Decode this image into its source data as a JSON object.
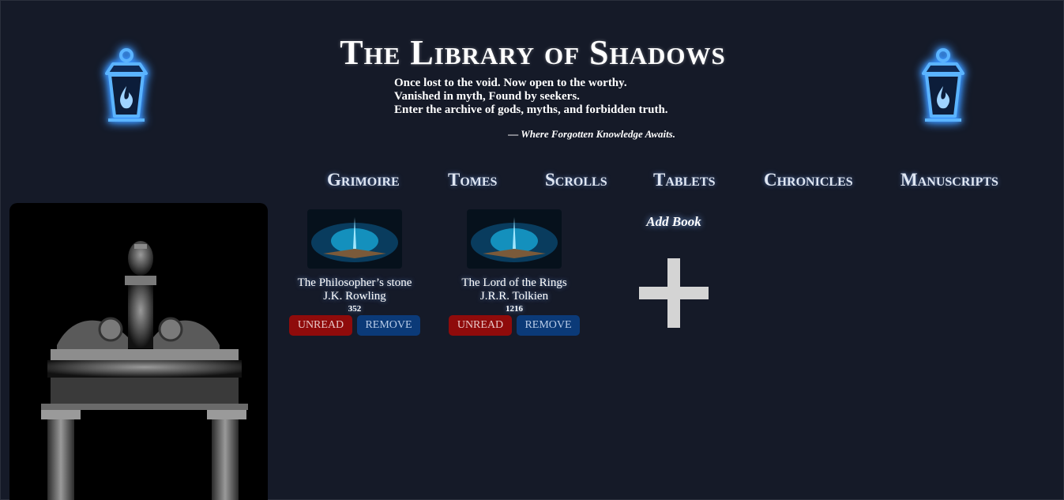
{
  "header": {
    "title": "The Library of Shadows",
    "subtitle_lines": [
      "Once lost to the void. Now open to the worthy.",
      "Vanished in myth, Found by seekers.",
      "Enter the archive of gods, myths, and forbidden truth."
    ],
    "tagline": "— Where Forgotten Knowledge Awaits."
  },
  "icons": {
    "left_lantern": "lantern-icon",
    "right_lantern": "lantern-icon",
    "add": "plus-icon"
  },
  "nav": {
    "items": [
      {
        "label": "Grimoire"
      },
      {
        "label": "Tomes"
      },
      {
        "label": "Scrolls"
      },
      {
        "label": "Tablets"
      },
      {
        "label": "Chronicles"
      },
      {
        "label": "Manuscripts"
      }
    ]
  },
  "books": [
    {
      "title": "The Philosopher’s stone",
      "author": "J.K. Rowling",
      "pages": "352",
      "status_label": "UNREAD",
      "remove_label": "REMOVE"
    },
    {
      "title": "The Lord of the Rings",
      "author": "J.R.R. Tolkien",
      "pages": "1216",
      "status_label": "UNREAD",
      "remove_label": "REMOVE"
    }
  ],
  "add_book": {
    "label": "Add Book"
  },
  "colors": {
    "background": "#151a28",
    "lantern_glow": "#2f8cff",
    "unread_button": "#8f0b0b",
    "remove_button": "#0b3a78",
    "plus": "#d4d4d4"
  }
}
